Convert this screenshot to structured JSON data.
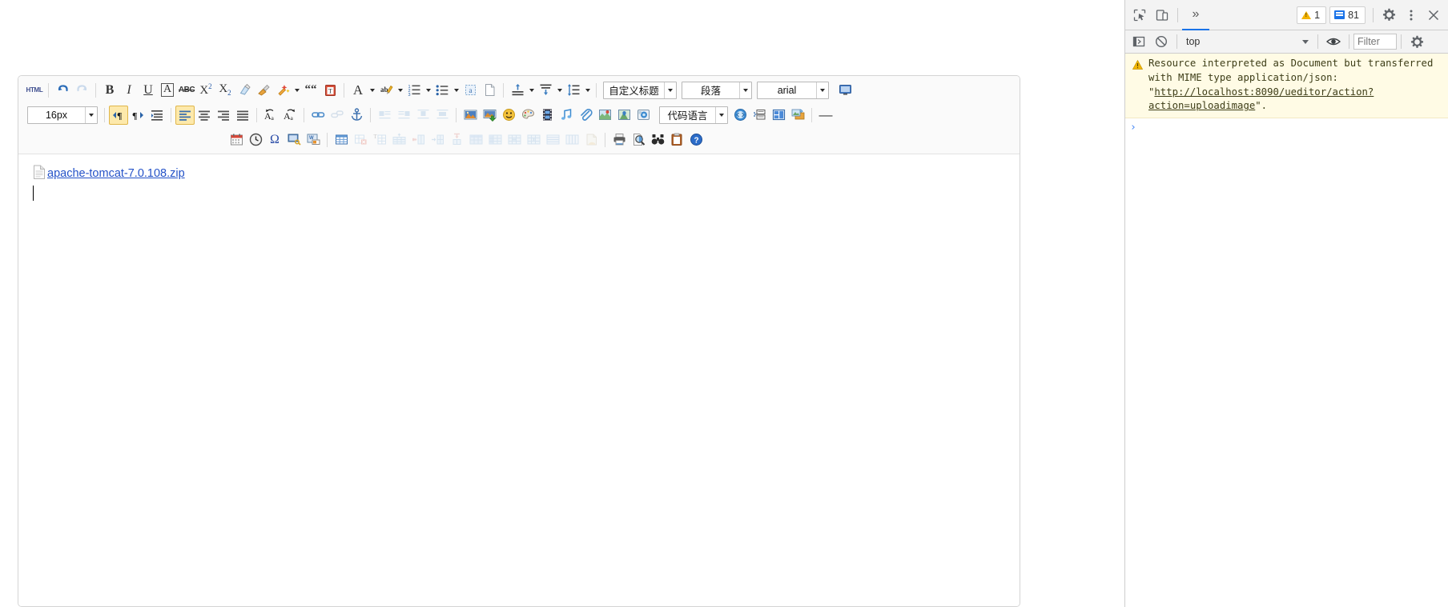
{
  "editor": {
    "toolbar_row1": [
      {
        "name": "source-html-button",
        "label": "HTML",
        "type": "text"
      },
      {
        "name": "separator",
        "type": "sep"
      },
      {
        "name": "undo-button",
        "type": "icon",
        "icon": "undo-icon"
      },
      {
        "name": "redo-button",
        "type": "icon",
        "icon": "redo-icon",
        "dim": true
      },
      {
        "name": "separator",
        "type": "sep"
      },
      {
        "name": "bold-button",
        "type": "glyph",
        "label": "B",
        "cls": "g-b"
      },
      {
        "name": "italic-button",
        "type": "glyph",
        "label": "I",
        "cls": "g-i"
      },
      {
        "name": "underline-button",
        "type": "glyph",
        "label": "U",
        "cls": "g-u"
      },
      {
        "name": "text-border-button",
        "type": "glyph",
        "label": "A",
        "cls": "g-box"
      },
      {
        "name": "strikethrough-button",
        "type": "glyph",
        "label": "ABC",
        "cls": "g-strike"
      },
      {
        "name": "superscript-button",
        "type": "html",
        "label": "X<sup>2</sup>",
        "cls": "g-sup"
      },
      {
        "name": "subscript-button",
        "type": "html",
        "label": "X<sub>2</sub>",
        "cls": "g-sub"
      },
      {
        "name": "remove-format-button",
        "type": "icon",
        "icon": "eraser-icon"
      },
      {
        "name": "format-match-button",
        "type": "icon",
        "icon": "paintbrush-icon"
      },
      {
        "name": "auto-typeset-button",
        "type": "icon",
        "icon": "magic-wand-icon",
        "caret": true
      },
      {
        "name": "blockquote-button",
        "type": "glyph",
        "label": "““",
        "cls": "g-quote"
      },
      {
        "name": "paste-plain-text-button",
        "type": "icon",
        "icon": "clipboard-text-icon"
      },
      {
        "name": "separator",
        "type": "sep"
      },
      {
        "name": "font-color-button",
        "type": "glyph",
        "label": "A",
        "cls": "g-A",
        "caret": true
      },
      {
        "name": "background-color-button",
        "type": "icon",
        "icon": "highlighter-icon",
        "caret": true
      },
      {
        "name": "ordered-list-button",
        "type": "icon",
        "icon": "numbered-list-icon",
        "caret": true
      },
      {
        "name": "unordered-list-button",
        "type": "icon",
        "icon": "bullet-list-icon",
        "caret": true
      },
      {
        "name": "anchor-text-button",
        "type": "icon",
        "icon": "a-dashed-box-icon"
      },
      {
        "name": "new-page-button",
        "type": "icon",
        "icon": "blank-page-icon"
      },
      {
        "name": "separator",
        "type": "sep"
      },
      {
        "name": "align-top-button",
        "type": "icon",
        "icon": "vertical-align-top-icon",
        "caret": true
      },
      {
        "name": "align-bottom-button",
        "type": "icon",
        "icon": "vertical-align-bottom-icon",
        "caret": true
      },
      {
        "name": "line-height-button",
        "type": "icon",
        "icon": "line-height-icon",
        "caret": true
      }
    ],
    "heading_select": {
      "name": "custom-heading-select",
      "value": "自定义标题"
    },
    "paragraph_select": {
      "name": "paragraph-format-select",
      "value": "段落"
    },
    "fontfamily_select": {
      "name": "font-family-select",
      "value": "arial"
    },
    "fullscreen_button": {
      "name": "fullscreen-button",
      "icon": "monitor-icon"
    },
    "fontsize_select": {
      "name": "font-size-select",
      "value": "16px"
    },
    "toolbar_row2": [
      {
        "name": "direction-ltr-button",
        "type": "icon",
        "icon": "paragraph-ltr-icon",
        "active": true
      },
      {
        "name": "direction-rtl-button",
        "type": "icon",
        "icon": "paragraph-rtl-icon"
      },
      {
        "name": "indent-button",
        "type": "icon",
        "icon": "indent-icon"
      },
      {
        "name": "separator",
        "type": "sep"
      },
      {
        "name": "align-left-button",
        "type": "icon",
        "icon": "align-left-icon",
        "active": true
      },
      {
        "name": "align-center-button",
        "type": "icon",
        "icon": "align-center-icon"
      },
      {
        "name": "align-right-button",
        "type": "icon",
        "icon": "align-right-icon"
      },
      {
        "name": "align-justify-button",
        "type": "icon",
        "icon": "align-justify-icon"
      },
      {
        "name": "separator",
        "type": "sep"
      },
      {
        "name": "undo-case-button",
        "type": "icon",
        "icon": "case-undo-icon"
      },
      {
        "name": "redo-case-button",
        "type": "icon",
        "icon": "case-redo-icon"
      },
      {
        "name": "separator",
        "type": "sep"
      },
      {
        "name": "insert-link-button",
        "type": "icon",
        "icon": "link-icon"
      },
      {
        "name": "unlink-button",
        "type": "icon",
        "icon": "unlink-icon",
        "dim": true
      },
      {
        "name": "anchor-button",
        "type": "icon",
        "icon": "anchor-icon"
      },
      {
        "name": "separator",
        "type": "sep"
      },
      {
        "name": "image-float-left-button",
        "type": "icon",
        "icon": "wrap-left-icon",
        "dim": true
      },
      {
        "name": "image-float-right-button",
        "type": "icon",
        "icon": "wrap-right-icon",
        "dim": true
      },
      {
        "name": "image-center-button",
        "type": "icon",
        "icon": "wrap-center-icon",
        "dim": true
      },
      {
        "name": "image-none-button",
        "type": "icon",
        "icon": "wrap-none-icon",
        "dim": true
      },
      {
        "name": "separator",
        "type": "sep"
      },
      {
        "name": "insert-image-button",
        "type": "icon",
        "icon": "picture-icon"
      },
      {
        "name": "upload-image-button",
        "type": "icon",
        "icon": "picture-upload-icon"
      },
      {
        "name": "emoticon-button",
        "type": "icon",
        "icon": "smiley-icon"
      },
      {
        "name": "scrawl-button",
        "type": "icon",
        "icon": "palette-icon"
      },
      {
        "name": "insert-video-button",
        "type": "icon",
        "icon": "film-icon"
      },
      {
        "name": "insert-music-button",
        "type": "icon",
        "icon": "music-note-icon"
      },
      {
        "name": "attachment-button",
        "type": "icon",
        "icon": "paperclip-icon"
      },
      {
        "name": "map-button",
        "type": "icon",
        "icon": "map-icon"
      },
      {
        "name": "gmap-button",
        "type": "icon",
        "icon": "gmap-icon"
      },
      {
        "name": "webapp-button",
        "type": "icon",
        "icon": "webapp-icon"
      }
    ],
    "codelang_select": {
      "name": "code-language-select",
      "value": "代码语言"
    },
    "toolbar_row2_tail": [
      {
        "name": "insert-code-button",
        "type": "icon",
        "icon": "code-circle-icon"
      },
      {
        "name": "template-button",
        "type": "icon",
        "icon": "template-icon"
      },
      {
        "name": "layout-button",
        "type": "icon",
        "icon": "layout-icon"
      },
      {
        "name": "background-button",
        "type": "icon",
        "icon": "background-icon"
      },
      {
        "name": "separator",
        "type": "sep"
      },
      {
        "name": "horizontal-rule-button",
        "type": "glyph",
        "label": "—",
        "cls": "g-dash"
      }
    ],
    "toolbar_row3": [
      {
        "name": "insert-date-button",
        "type": "icon",
        "icon": "calendar-icon"
      },
      {
        "name": "insert-time-button",
        "type": "icon",
        "icon": "clock-icon"
      },
      {
        "name": "special-character-button",
        "type": "glyph",
        "label": "Ω",
        "cls": "g-omega"
      },
      {
        "name": "screenshot-button",
        "type": "icon",
        "icon": "screenshot-key-icon"
      },
      {
        "name": "import-word-button",
        "type": "icon",
        "icon": "word-import-icon"
      },
      {
        "name": "separator",
        "type": "sep"
      },
      {
        "name": "insert-table-button",
        "type": "icon",
        "icon": "table-icon"
      },
      {
        "name": "delete-table-button",
        "type": "icon",
        "icon": "table-delete-icon",
        "dim": true
      },
      {
        "name": "table-title-button",
        "type": "icon",
        "icon": "table-caption-icon",
        "dim": true
      },
      {
        "name": "insert-row-button",
        "type": "icon",
        "icon": "table-insert-row-icon",
        "dim": true
      },
      {
        "name": "insert-col-button",
        "type": "icon",
        "icon": "table-insert-col-icon",
        "dim": true
      },
      {
        "name": "split-cell-button",
        "type": "icon",
        "icon": "table-split-cell-icon",
        "dim": true
      },
      {
        "name": "merge-cell-button",
        "type": "icon",
        "icon": "table-merge-cell-icon",
        "dim": true
      },
      {
        "name": "delete-row-button",
        "type": "icon",
        "icon": "table-delete-row-icon",
        "dim": true
      },
      {
        "name": "delete-col-button",
        "type": "icon",
        "icon": "table-delete-col-icon",
        "dim": true
      },
      {
        "name": "merge-right-button",
        "type": "icon",
        "icon": "table-merge-right-icon",
        "dim": true
      },
      {
        "name": "merge-down-button",
        "type": "icon",
        "icon": "table-merge-down-icon",
        "dim": true
      },
      {
        "name": "split-rows-button",
        "type": "icon",
        "icon": "table-split-rows-icon",
        "dim": true
      },
      {
        "name": "split-cols-button",
        "type": "icon",
        "icon": "table-split-cols-icon",
        "dim": true
      },
      {
        "name": "table-sort-button",
        "type": "icon",
        "icon": "table-sort-icon",
        "dim": true
      },
      {
        "name": "separator",
        "type": "sep"
      },
      {
        "name": "print-button",
        "type": "icon",
        "icon": "printer-icon"
      },
      {
        "name": "preview-button",
        "type": "icon",
        "icon": "print-preview-icon"
      },
      {
        "name": "search-replace-button",
        "type": "icon",
        "icon": "binoculars-icon"
      },
      {
        "name": "select-all-button",
        "type": "icon",
        "icon": "clipboard-icon"
      },
      {
        "name": "help-button",
        "type": "icon",
        "icon": "help-icon"
      }
    ],
    "content": {
      "attachment_name": "apache-tomcat-7.0.108.zip"
    }
  },
  "devtools": {
    "toolbar": {
      "inspect_label": "inspect-element",
      "device_label": "device-toolbar",
      "more_tabs_label": "»",
      "warning_count": "1",
      "message_count": "81",
      "settings_label": "settings",
      "kebab_label": "more-options",
      "close_label": "close"
    },
    "console_bar": {
      "sidebar_label": "console-sidebar",
      "clear_label": "clear-console",
      "context_value": "top",
      "eye_label": "live-expressions",
      "filter_placeholder": "Filter",
      "filter_value": "",
      "settings_label": "console-settings"
    },
    "messages": [
      {
        "level": "warning",
        "text_before": "Resource interpreted as Document but transferred with MIME type application/json: \"",
        "link": "http://localhost:8090/ueditor/action?action=uploadimage",
        "text_after": "\"."
      }
    ],
    "prompt": {
      "arrow": "›"
    }
  },
  "colors": {
    "link": "#2452c8",
    "active_toolbar": "#fde9ab",
    "warning_bg": "#fffbe5",
    "devtools_accent": "#1a73e8"
  }
}
